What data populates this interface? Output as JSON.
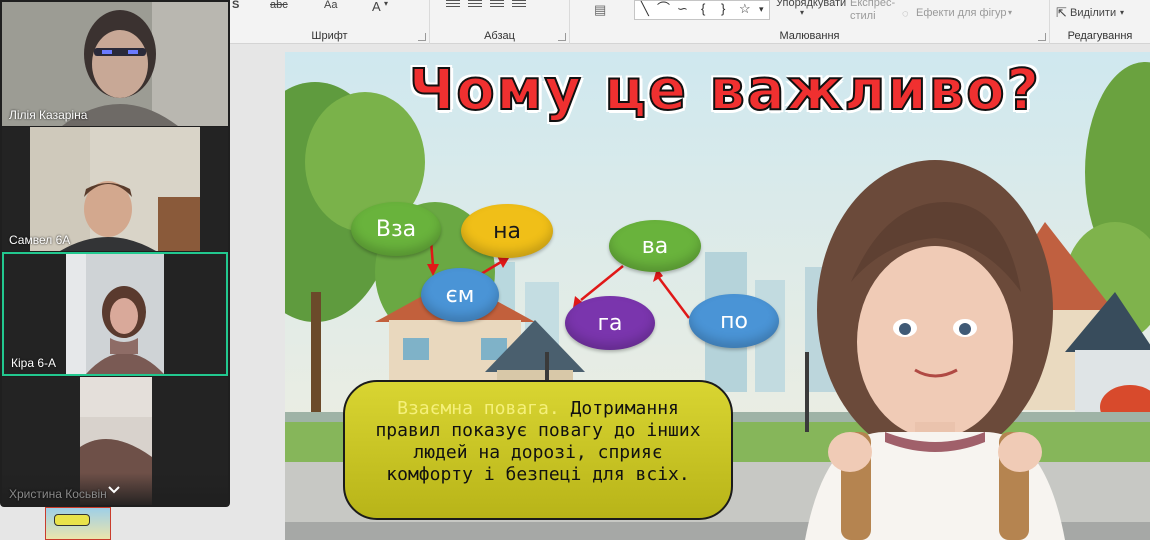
{
  "ribbon": {
    "groups": {
      "font": "Шрифт",
      "paragraph": "Абзац",
      "drawing": "Малювання",
      "editing": "Редагування"
    },
    "arrange_label": "Упорядкувати",
    "quick_styles_label": "Експрес-стилі",
    "shape_effects_label": "Ефекти для фігур",
    "select_label": "Виділити",
    "font_glyphs": [
      "S",
      "abc",
      "Aa",
      "A"
    ]
  },
  "participants": [
    {
      "name": "Лілія Казаріна",
      "active": false
    },
    {
      "name": "Самвел 6А",
      "active": false
    },
    {
      "name": "Кіра 6-А",
      "active": true
    },
    {
      "name": "Христина Косьвін",
      "active": false
    }
  ],
  "slide": {
    "title": "Чому це важливо?",
    "syllables": [
      "Вза",
      "на",
      "єм",
      "ва",
      "га",
      "по"
    ],
    "info_highlight": "Взаємна повага.",
    "info_text": "Дотримання правил показує повагу до інших людей на дорозі, сприяє комфорту і безпеці для всіх."
  },
  "colors": {
    "green_bubble": "#69b33c",
    "yellow_bubble": "#f0bf18",
    "blue_bubble": "#4a94d6",
    "purple_bubble": "#7a35ad",
    "title_red": "#f03030",
    "active_border": "#22c88f",
    "info_box": "#c9c52a"
  }
}
